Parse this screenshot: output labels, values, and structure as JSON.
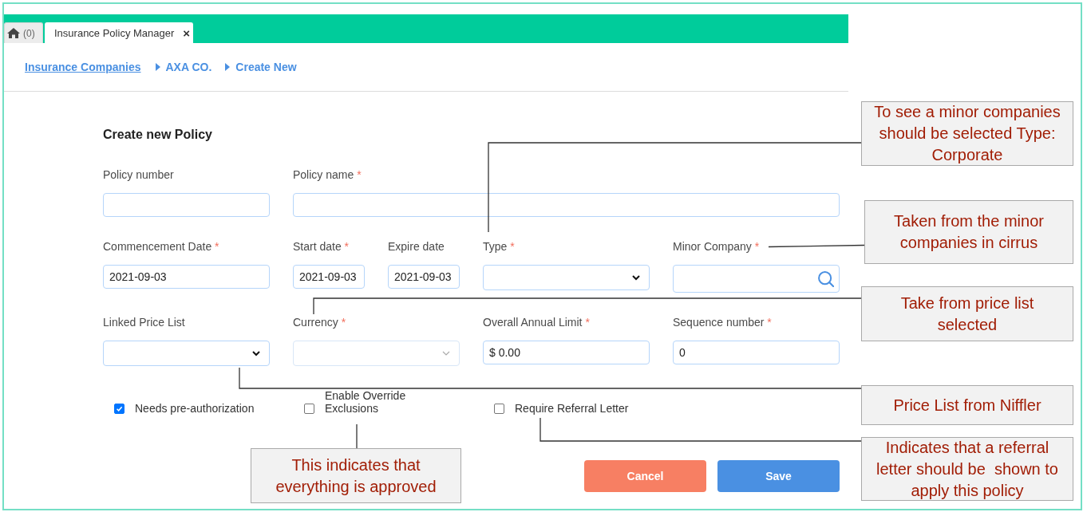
{
  "tabs": [
    {
      "kind": "home",
      "label": "(0)",
      "selected": false
    },
    {
      "kind": "page",
      "label": "Insurance Policy Manager",
      "close": "×",
      "selected": true
    }
  ],
  "breadcrumb": [
    {
      "kind": "link",
      "label": "Insurance Companies"
    },
    {
      "kind": "crumb",
      "label": "AXA CO."
    },
    {
      "kind": "crumb",
      "label": "Create New"
    }
  ],
  "form": {
    "title": "Create new Policy",
    "rows": [
      [
        [
          {
            "label": "Policy number",
            "kind": "text",
            "disabled": false
          }
        ],
        [
          {
            "label": "Policy name",
            "required_mark": "*",
            "kind": "text",
            "disabled": false
          }
        ]
      ],
      [
        [
          {
            "label": "Commencement Date",
            "required_mark": "*",
            "kind": "date",
            "value": "2021-09-03",
            "disabled": false
          }
        ],
        [
          {
            "label": "Start date",
            "required_mark": "*",
            "kind": "date",
            "value": "2021-09-03",
            "disabled": false
          },
          {
            "label": "Expire date",
            "kind": "date",
            "value": "2021-09-03",
            "disabled": false
          }
        ],
        [
          {
            "label": "Type",
            "required_mark": "*",
            "kind": "select",
            "disabled": false
          }
        ],
        [
          {
            "label": "Minor Company",
            "required_mark": "*",
            "kind": "search",
            "disabled": false
          }
        ]
      ],
      [
        [
          {
            "label": "Linked Price List",
            "kind": "select",
            "disabled": false
          }
        ],
        [
          {
            "label": "Currency",
            "required_mark": "*",
            "kind": "select",
            "disabled": true
          }
        ],
        [
          {
            "label": "Overall Annual Limit",
            "required_mark": "*",
            "kind": "text",
            "value": "$ 0.00",
            "disabled": false
          }
        ],
        [
          {
            "label": "Sequence number",
            "required_mark": "*",
            "kind": "text",
            "value": "0",
            "disabled": false
          }
        ]
      ]
    ],
    "checkboxes": [
      {
        "label": "Needs pre-authorization",
        "checked": true
      },
      {
        "label": "Enable Override Exclusions",
        "checked": false
      },
      {
        "label": "Require Referral Letter",
        "checked": false
      }
    ],
    "buttons": [
      {
        "kind": "cancel",
        "label": "Cancel"
      },
      {
        "kind": "save",
        "label": "Save"
      }
    ]
  },
  "annotations": [
    {
      "text": "To see a minor companies should be selected Type: Corporate"
    },
    {
      "text": "Taken from the minor companies in cirrus"
    },
    {
      "text": "Take from price list selected"
    },
    {
      "text": "Price List from Niffler"
    },
    {
      "text": "This indicates that everything is approved"
    },
    {
      "text": "Indicates that a referral letter should be  shown to apply this policy"
    }
  ]
}
